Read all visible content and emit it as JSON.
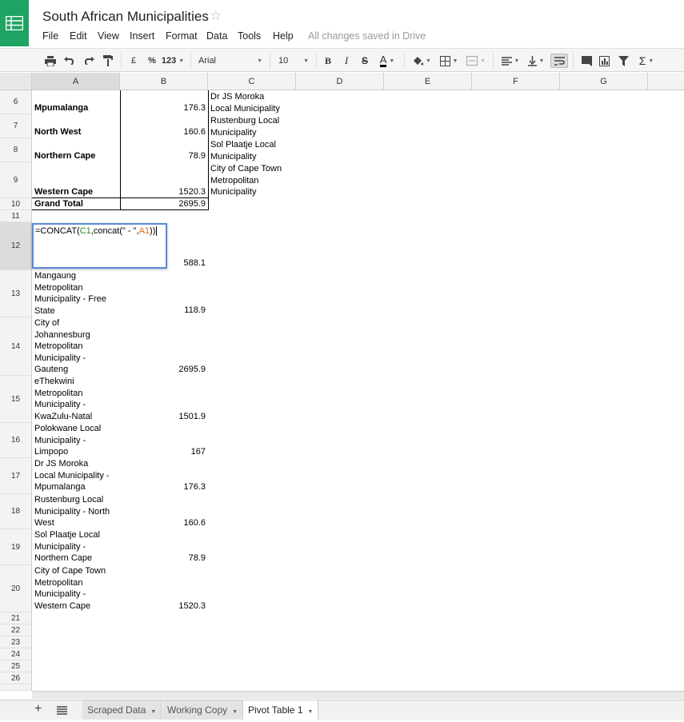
{
  "doc": {
    "title": "South African Municipalities",
    "saved": "All changes saved in Drive"
  },
  "menu": [
    "File",
    "Edit",
    "View",
    "Insert",
    "Format",
    "Data",
    "Tools",
    "Help"
  ],
  "toolbar": {
    "currency": "£",
    "percent": "%",
    "numformat": "123",
    "font": "Arial",
    "size": "10",
    "bold": "B",
    "italic": "I",
    "strike": "S",
    "textcolor": "A",
    "sum": "Σ"
  },
  "columns": [
    "A",
    "B",
    "C",
    "D",
    "E",
    "F",
    "G"
  ],
  "rows": [
    "6",
    "7",
    "8",
    "9",
    "10",
    "11",
    "12",
    "13",
    "14",
    "15",
    "16",
    "17",
    "18",
    "19",
    "20",
    "21",
    "22",
    "23",
    "24",
    "25",
    "26"
  ],
  "pivot": [
    {
      "a": "Mpumalanga",
      "b": "176.3",
      "c": [
        "Dr JS Moroka",
        "Local Municipality"
      ]
    },
    {
      "a": "North West",
      "b": "160.6",
      "c": [
        "Rustenburg Local",
        "Municipality"
      ]
    },
    {
      "a": "Northern Cape",
      "b": "78.9",
      "c": [
        "Sol Plaatje Local",
        "Municipality"
      ]
    },
    {
      "a": "Western Cape",
      "b": "1520.3",
      "c": [
        "City of Cape Town",
        "Metropolitan",
        "Municipality"
      ]
    },
    {
      "a": "Grand Total",
      "b": "2695.9"
    }
  ],
  "formula": {
    "prefix": "=CONCAT(",
    "ref1": "C1",
    "mid": ",concat(\" - \",",
    "ref2": "A1",
    "suffix": "))"
  },
  "row12_b": "588.1",
  "list": [
    {
      "a": [
        "Mangaung",
        "Metropolitan",
        "Municipality - Free",
        "State"
      ],
      "b": "118.9"
    },
    {
      "a": [
        "City of",
        "Johannesburg",
        "Metropolitan",
        "Municipality -",
        "Gauteng"
      ],
      "b": "2695.9"
    },
    {
      "a": [
        "eThekwini",
        "Metropolitan",
        "Municipality -",
        "KwaZulu-Natal"
      ],
      "b": "1501.9"
    },
    {
      "a": [
        "Polokwane Local",
        "Municipality -",
        "Limpopo"
      ],
      "b": "167"
    },
    {
      "a": [
        "Dr JS Moroka",
        "Local Municipality -",
        "Mpumalanga"
      ],
      "b": "176.3"
    },
    {
      "a": [
        "Rustenburg Local",
        "Municipality - North",
        "West"
      ],
      "b": "160.6"
    },
    {
      "a": [
        "Sol Plaatje Local",
        "Municipality -",
        "Northern Cape"
      ],
      "b": "78.9"
    },
    {
      "a": [
        "City of Cape Town",
        "Metropolitan",
        "Municipality -",
        "Western Cape"
      ],
      "b": "1520.3"
    }
  ],
  "sheets": [
    {
      "name": "Scraped Data"
    },
    {
      "name": "Working Copy"
    },
    {
      "name": "Pivot Table 1"
    }
  ],
  "colors": {
    "brand": "#1fa463",
    "selection": "#5b8bd9",
    "ref1": "#2a8a2a",
    "ref2": "#e06a1a"
  }
}
